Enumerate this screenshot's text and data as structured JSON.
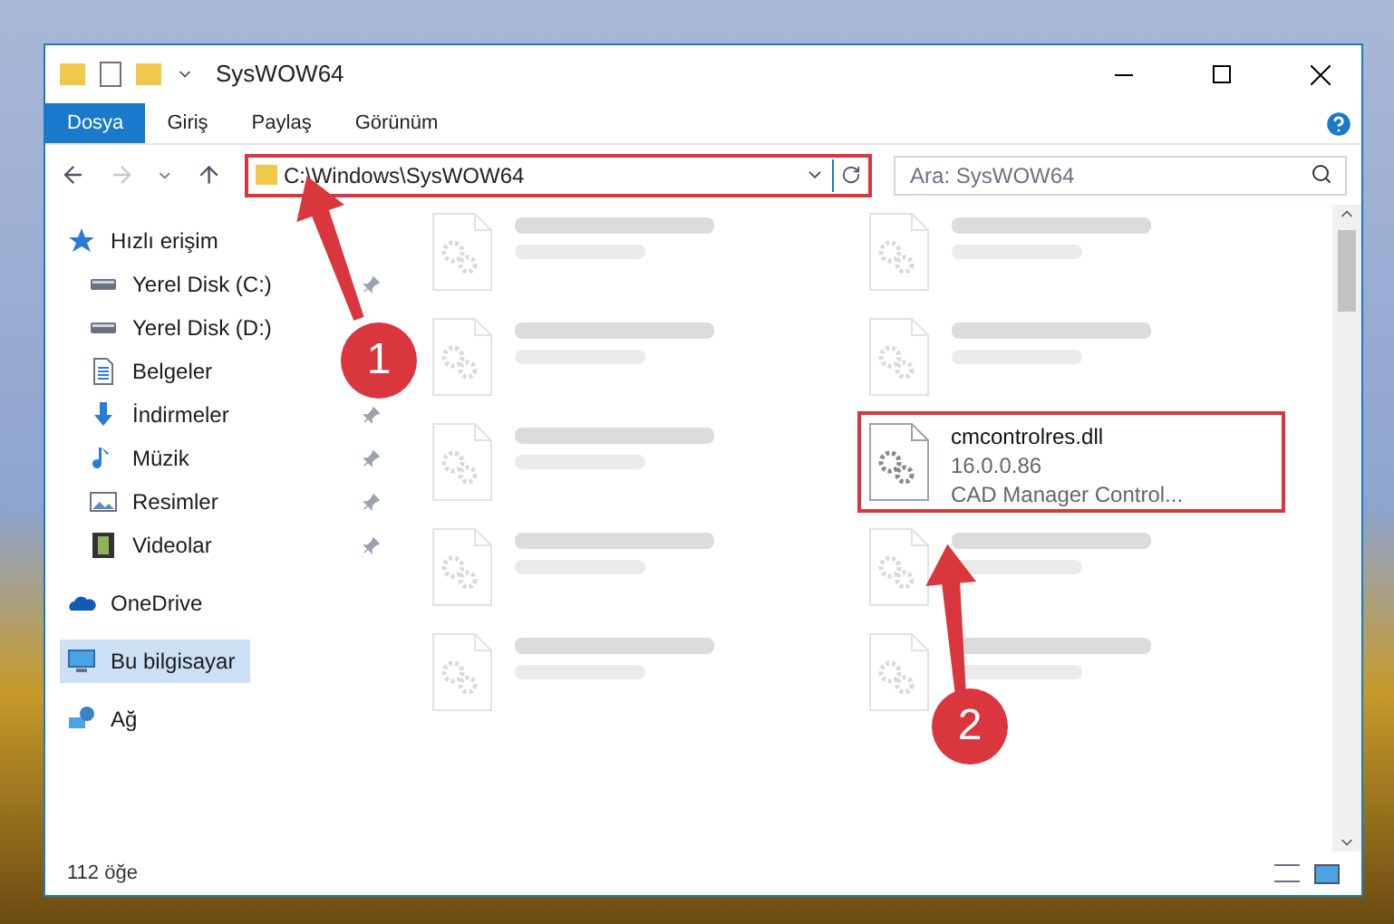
{
  "window": {
    "title": "SysWOW64"
  },
  "ribbon_tabs": [
    {
      "label": "Dosya",
      "selected": true
    },
    {
      "label": "Giriş",
      "selected": false
    },
    {
      "label": "Paylaş",
      "selected": false
    },
    {
      "label": "Görünüm",
      "selected": false
    }
  ],
  "address_bar": {
    "path": "C:\\Windows\\SysWOW64",
    "highlighted": true
  },
  "search": {
    "placeholder": "Ara: SysWOW64"
  },
  "sidebar": {
    "items": [
      {
        "label": "Hızlı erişim",
        "kind": "star",
        "selected": false,
        "pinned": false,
        "children": [
          {
            "label": "Yerel Disk (C:)",
            "kind": "disk",
            "selected": false,
            "pinned": true
          },
          {
            "label": "Yerel Disk (D:)",
            "kind": "disk",
            "selected": false,
            "pinned": false
          },
          {
            "label": "Belgeler",
            "kind": "document",
            "selected": false,
            "pinned": false
          },
          {
            "label": "İndirmeler",
            "kind": "download",
            "selected": false,
            "pinned": true
          },
          {
            "label": "Müzik",
            "kind": "music",
            "selected": false,
            "pinned": true
          },
          {
            "label": "Resimler",
            "kind": "picture",
            "selected": false,
            "pinned": true
          },
          {
            "label": "Videolar",
            "kind": "video",
            "selected": false,
            "pinned": true
          }
        ]
      },
      {
        "label": "OneDrive",
        "kind": "cloud",
        "selected": false,
        "pinned": false
      },
      {
        "label": "Bu bilgisayar",
        "kind": "computer",
        "selected": true,
        "pinned": false
      },
      {
        "label": "Ağ",
        "kind": "network",
        "selected": false,
        "pinned": false
      }
    ]
  },
  "files": [
    {
      "kind": "blurred"
    },
    {
      "kind": "blurred"
    },
    {
      "kind": "blurred"
    },
    {
      "kind": "blurred"
    },
    {
      "kind": "blurred"
    },
    {
      "kind": "file",
      "name": "cmcontrolres.dll",
      "lines": [
        "16.0.0.86",
        "CAD Manager Control..."
      ],
      "highlighted": true
    },
    {
      "kind": "blurred"
    },
    {
      "kind": "blurred"
    },
    {
      "kind": "blurred"
    },
    {
      "kind": "blurred"
    }
  ],
  "annotations": [
    {
      "label": "1"
    },
    {
      "label": "2"
    }
  ],
  "status_bar": {
    "item_count": "112 öğe"
  }
}
